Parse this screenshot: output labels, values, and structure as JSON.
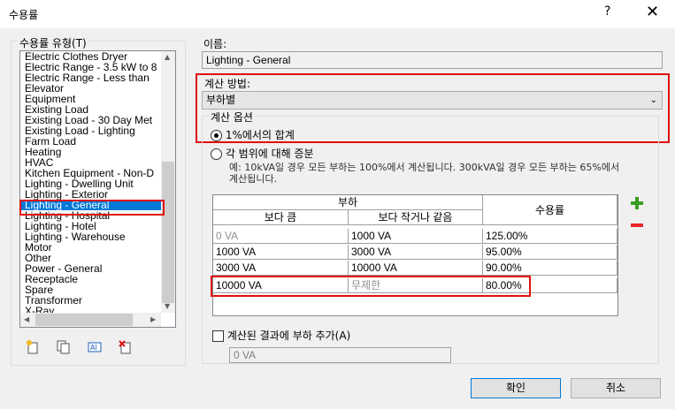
{
  "window": {
    "title": "수용률",
    "help": "?",
    "close": "✕"
  },
  "list_group": {
    "label": "수용률 유형(T)",
    "items": [
      "Electric Clothes Dryer",
      "Electric Range - 3.5 kW to 8",
      "Electric Range - Less than",
      "Elevator",
      "Equipment",
      "Existing Load",
      "Existing Load - 30 Day Met",
      "Existing Load - Lighting",
      "Farm Load",
      "Heating",
      "HVAC",
      "Kitchen Equipment - Non-D",
      "Lighting - Dwelling Unit",
      "Lighting - Exterior",
      "Lighting - General",
      "Lighting - Hospital",
      "Lighting - Hotel",
      "Lighting - Warehouse",
      "Motor",
      "Other",
      "Power - General",
      "Receptacle",
      "Spare",
      "Transformer",
      "X-Ray"
    ],
    "selected_index": 14,
    "toolbar_icons": [
      "new-type-icon",
      "duplicate-icon",
      "rename-icon",
      "delete-icon"
    ]
  },
  "name": {
    "label": "이름:",
    "value": "Lighting - General"
  },
  "calc_method": {
    "label": "계산 방법:",
    "value": "부하별"
  },
  "calc_options": {
    "label": "계산 옵션",
    "option1": "1%에서의 합계",
    "option2": "각 범위에 대해 증분",
    "description": "예: 10kVA일 경우 모든 부하는 100%에서 계산됩니다. 300kVA일 경우 모든 부하는 65%에서 계산됩니다."
  },
  "table": {
    "header_load": "부하",
    "header_greater": "보다 큼",
    "header_less_equal": "보다 작거나 같음",
    "header_factor": "수용률",
    "rows": [
      {
        "greater": "0 VA",
        "less": "1000 VA",
        "factor": "125.00%"
      },
      {
        "greater": "1000 VA",
        "less": "3000 VA",
        "factor": "95.00%"
      },
      {
        "greater": "3000 VA",
        "less": "10000 VA",
        "factor": "90.00%"
      },
      {
        "greater": "10000 VA",
        "less": "무제한",
        "factor": "80.00%"
      }
    ]
  },
  "add_load": {
    "label": "계산된 결과에 부하 추가(A)",
    "value": "0 VA"
  },
  "buttons": {
    "ok": "확인",
    "cancel": "취소"
  },
  "colors": {
    "highlight": "#e01010",
    "selection": "#0078d7",
    "add": "#3a9d23",
    "remove": "#e8262a"
  }
}
